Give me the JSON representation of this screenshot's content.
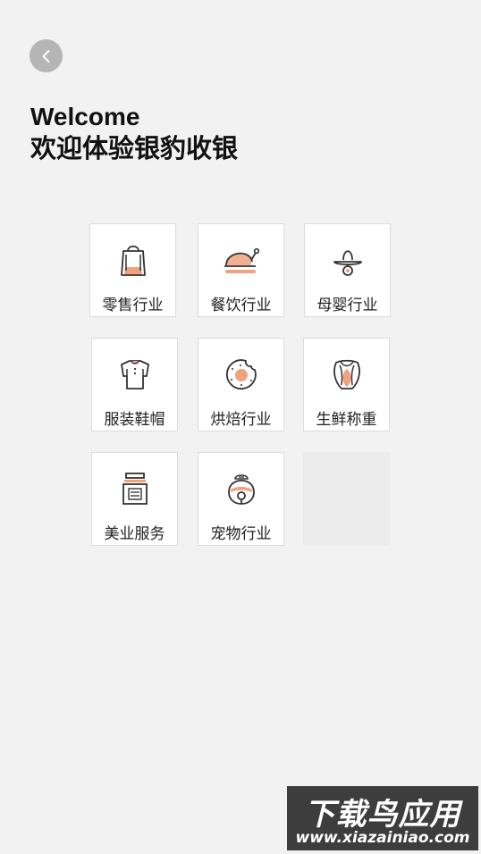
{
  "header": {
    "back_icon": "chevron-left-icon",
    "welcome": "Welcome",
    "subtitle": "欢迎体验银豹收银"
  },
  "industries": [
    {
      "label": "零售行业",
      "icon": "shopping-bag-icon"
    },
    {
      "label": "餐饮行业",
      "icon": "roast-chicken-icon"
    },
    {
      "label": "母婴行业",
      "icon": "pacifier-icon"
    },
    {
      "label": "服装鞋帽",
      "icon": "shirt-icon"
    },
    {
      "label": "烘焙行业",
      "icon": "cookie-icon"
    },
    {
      "label": "生鲜称重",
      "icon": "fresh-produce-icon"
    },
    {
      "label": "美业服务",
      "icon": "perfume-bottle-icon"
    },
    {
      "label": "宠物行业",
      "icon": "pet-bell-icon"
    }
  ],
  "watermark": {
    "title": "下载鸟应用",
    "url": "www.xiazainiao.com"
  },
  "colors": {
    "accent": "#f0a27e",
    "stroke": "#333333",
    "background": "#f2f2f2"
  }
}
